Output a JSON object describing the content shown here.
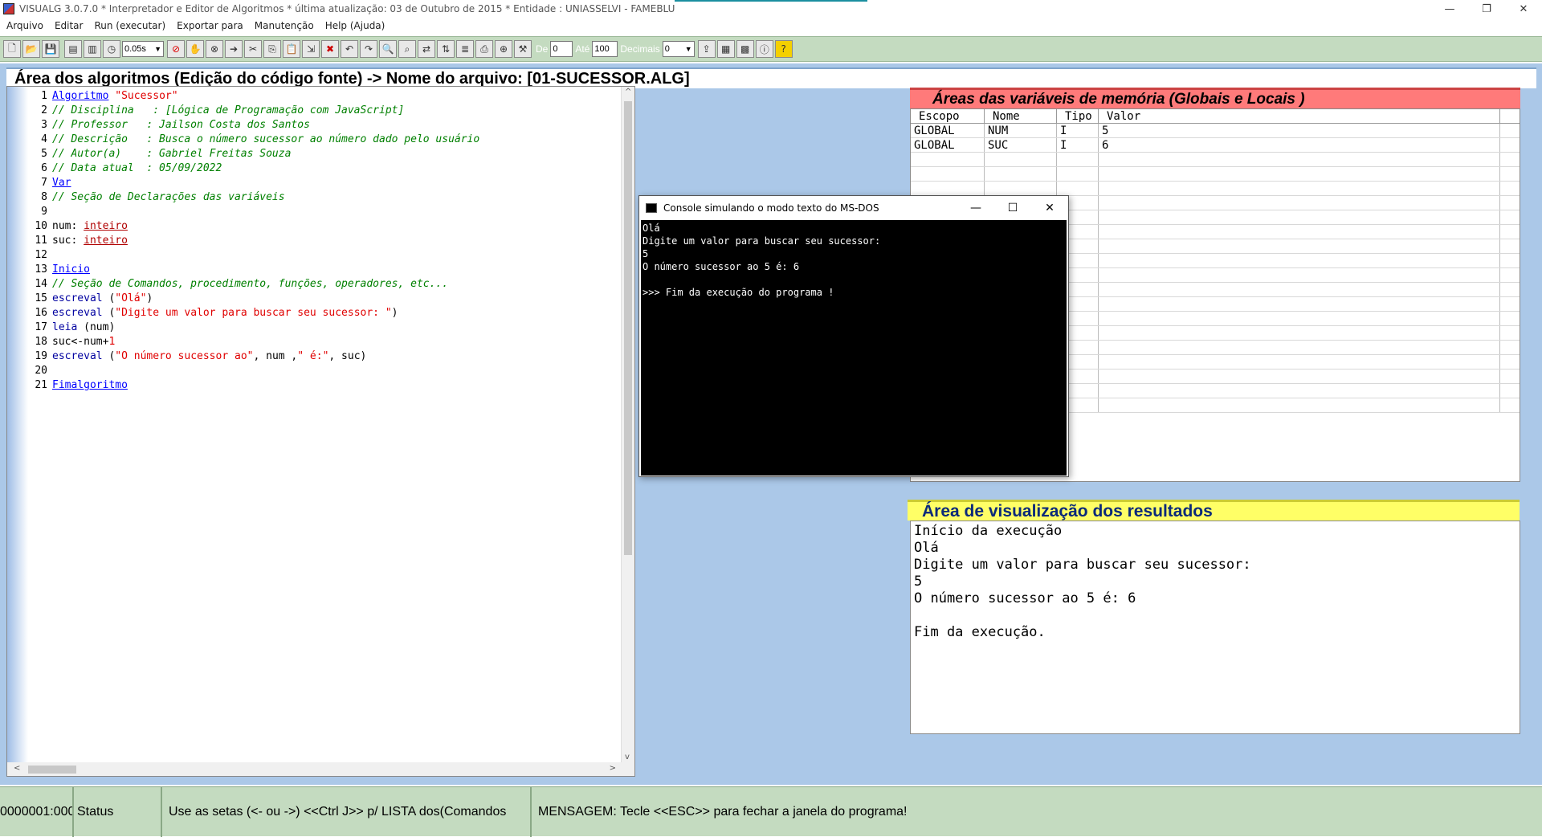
{
  "window": {
    "title": "VISUALG 3.0.7.0 * Interpretador e Editor de Algoritmos * última atualização: 03 de Outubro de 2015 * Entidade : UNIASSELVI - FAMEBLU",
    "minimize": "—",
    "restore": "❐",
    "close": "✕"
  },
  "menu": [
    "Arquivo",
    "Editar",
    "Run (executar)",
    "Exportar para",
    "Manutenção",
    "Help (Ajuda)"
  ],
  "toolbar": {
    "speed": "0.05s",
    "de_label": "De",
    "de_value": "0",
    "ate_label": "Até",
    "ate_value": "100",
    "decimais_label": "Decimais",
    "decimais_value": "0"
  },
  "editor": {
    "header": "Área dos algoritmos (Edição do código fonte) -> Nome do arquivo: [01-SUCESSOR.ALG]",
    "lines": [
      {
        "n": "1",
        "parts": [
          {
            "t": "Algoritmo",
            "c": "kw"
          },
          {
            "t": " ",
            "c": "plain"
          },
          {
            "t": "\"Sucessor\"",
            "c": "str"
          }
        ]
      },
      {
        "n": "2",
        "parts": [
          {
            "t": "// Disciplina   : [Lógica de Programação com JavaScript]",
            "c": "cmt"
          }
        ]
      },
      {
        "n": "3",
        "parts": [
          {
            "t": "// Professor   : Jailson Costa dos Santos",
            "c": "cmt"
          }
        ]
      },
      {
        "n": "4",
        "parts": [
          {
            "t": "// Descrição   : Busca o número sucessor ao número dado pelo usuário",
            "c": "cmt"
          }
        ]
      },
      {
        "n": "5",
        "parts": [
          {
            "t": "// Autor(a)    : Gabriel Freitas Souza",
            "c": "cmt"
          }
        ]
      },
      {
        "n": "6",
        "parts": [
          {
            "t": "// Data atual  : 05/09/2022",
            "c": "cmt"
          }
        ]
      },
      {
        "n": "7",
        "parts": [
          {
            "t": "Var",
            "c": "kw"
          }
        ]
      },
      {
        "n": "8",
        "parts": [
          {
            "t": "// Seção de Declarações das variáveis",
            "c": "cmt"
          }
        ]
      },
      {
        "n": "9",
        "parts": []
      },
      {
        "n": "10",
        "parts": [
          {
            "t": "num: ",
            "c": "plain"
          },
          {
            "t": "inteiro",
            "c": "typ"
          }
        ]
      },
      {
        "n": "11",
        "parts": [
          {
            "t": "suc: ",
            "c": "plain"
          },
          {
            "t": "inteiro",
            "c": "typ"
          }
        ]
      },
      {
        "n": "12",
        "parts": []
      },
      {
        "n": "13",
        "parts": [
          {
            "t": "Inicio",
            "c": "kw"
          }
        ]
      },
      {
        "n": "14",
        "parts": [
          {
            "t": "// Seção de Comandos, procedimento, funções, operadores, etc...",
            "c": "cmt"
          }
        ]
      },
      {
        "n": "15",
        "parts": [
          {
            "t": "escreval",
            "c": "cmd"
          },
          {
            "t": " (",
            "c": "plain"
          },
          {
            "t": "\"Olá\"",
            "c": "str"
          },
          {
            "t": ")",
            "c": "plain"
          }
        ]
      },
      {
        "n": "16",
        "parts": [
          {
            "t": "escreval",
            "c": "cmd"
          },
          {
            "t": " (",
            "c": "plain"
          },
          {
            "t": "\"Digite um valor para buscar seu sucessor: \"",
            "c": "str"
          },
          {
            "t": ")",
            "c": "plain"
          }
        ]
      },
      {
        "n": "17",
        "parts": [
          {
            "t": "leia",
            "c": "cmd"
          },
          {
            "t": " (num)",
            "c": "plain"
          }
        ]
      },
      {
        "n": "18",
        "parts": [
          {
            "t": "suc<-num+",
            "c": "plain"
          },
          {
            "t": "1",
            "c": "str"
          }
        ]
      },
      {
        "n": "19",
        "parts": [
          {
            "t": "escreval",
            "c": "cmd"
          },
          {
            "t": " (",
            "c": "plain"
          },
          {
            "t": "\"O número sucessor ao\"",
            "c": "str"
          },
          {
            "t": ", num ,",
            "c": "plain"
          },
          {
            "t": "\" é:\"",
            "c": "str"
          },
          {
            "t": ", suc)",
            "c": "plain"
          }
        ]
      },
      {
        "n": "20",
        "parts": []
      },
      {
        "n": "21",
        "parts": [
          {
            "t": "Fimalgoritmo",
            "c": "kw"
          }
        ]
      }
    ]
  },
  "variables": {
    "header": "Áreas das variáveis de memória (Globais e Locais )",
    "columns": [
      "Escopo",
      "Nome",
      "Tipo",
      "Valor"
    ],
    "rows": [
      [
        "GLOBAL",
        "NUM",
        "I",
        "5"
      ],
      [
        "GLOBAL",
        "SUC",
        "I",
        "6"
      ]
    ],
    "empty_rows": 18
  },
  "results": {
    "header": "Área de visualização dos resultados",
    "text": "Início da execução\nOlá\nDigite um valor para buscar seu sucessor:\n5\nO número sucessor ao 5 é: 6\n\nFim da execução."
  },
  "console": {
    "title": "Console simulando o modo texto do MS-DOS",
    "text": "Olá\nDigite um valor para buscar seu sucessor:\n5\nO número sucessor ao 5 é: 6\n\n>>> Fim da execução do programa !"
  },
  "status": {
    "position": "0000001:000",
    "label": "Status",
    "hint": "Use as setas (<- ou ->) <<Ctrl J>> p/ LISTA dos(Comandos",
    "message": "MENSAGEM: Tecle <<ESC>> para fechar a janela do programa!"
  }
}
